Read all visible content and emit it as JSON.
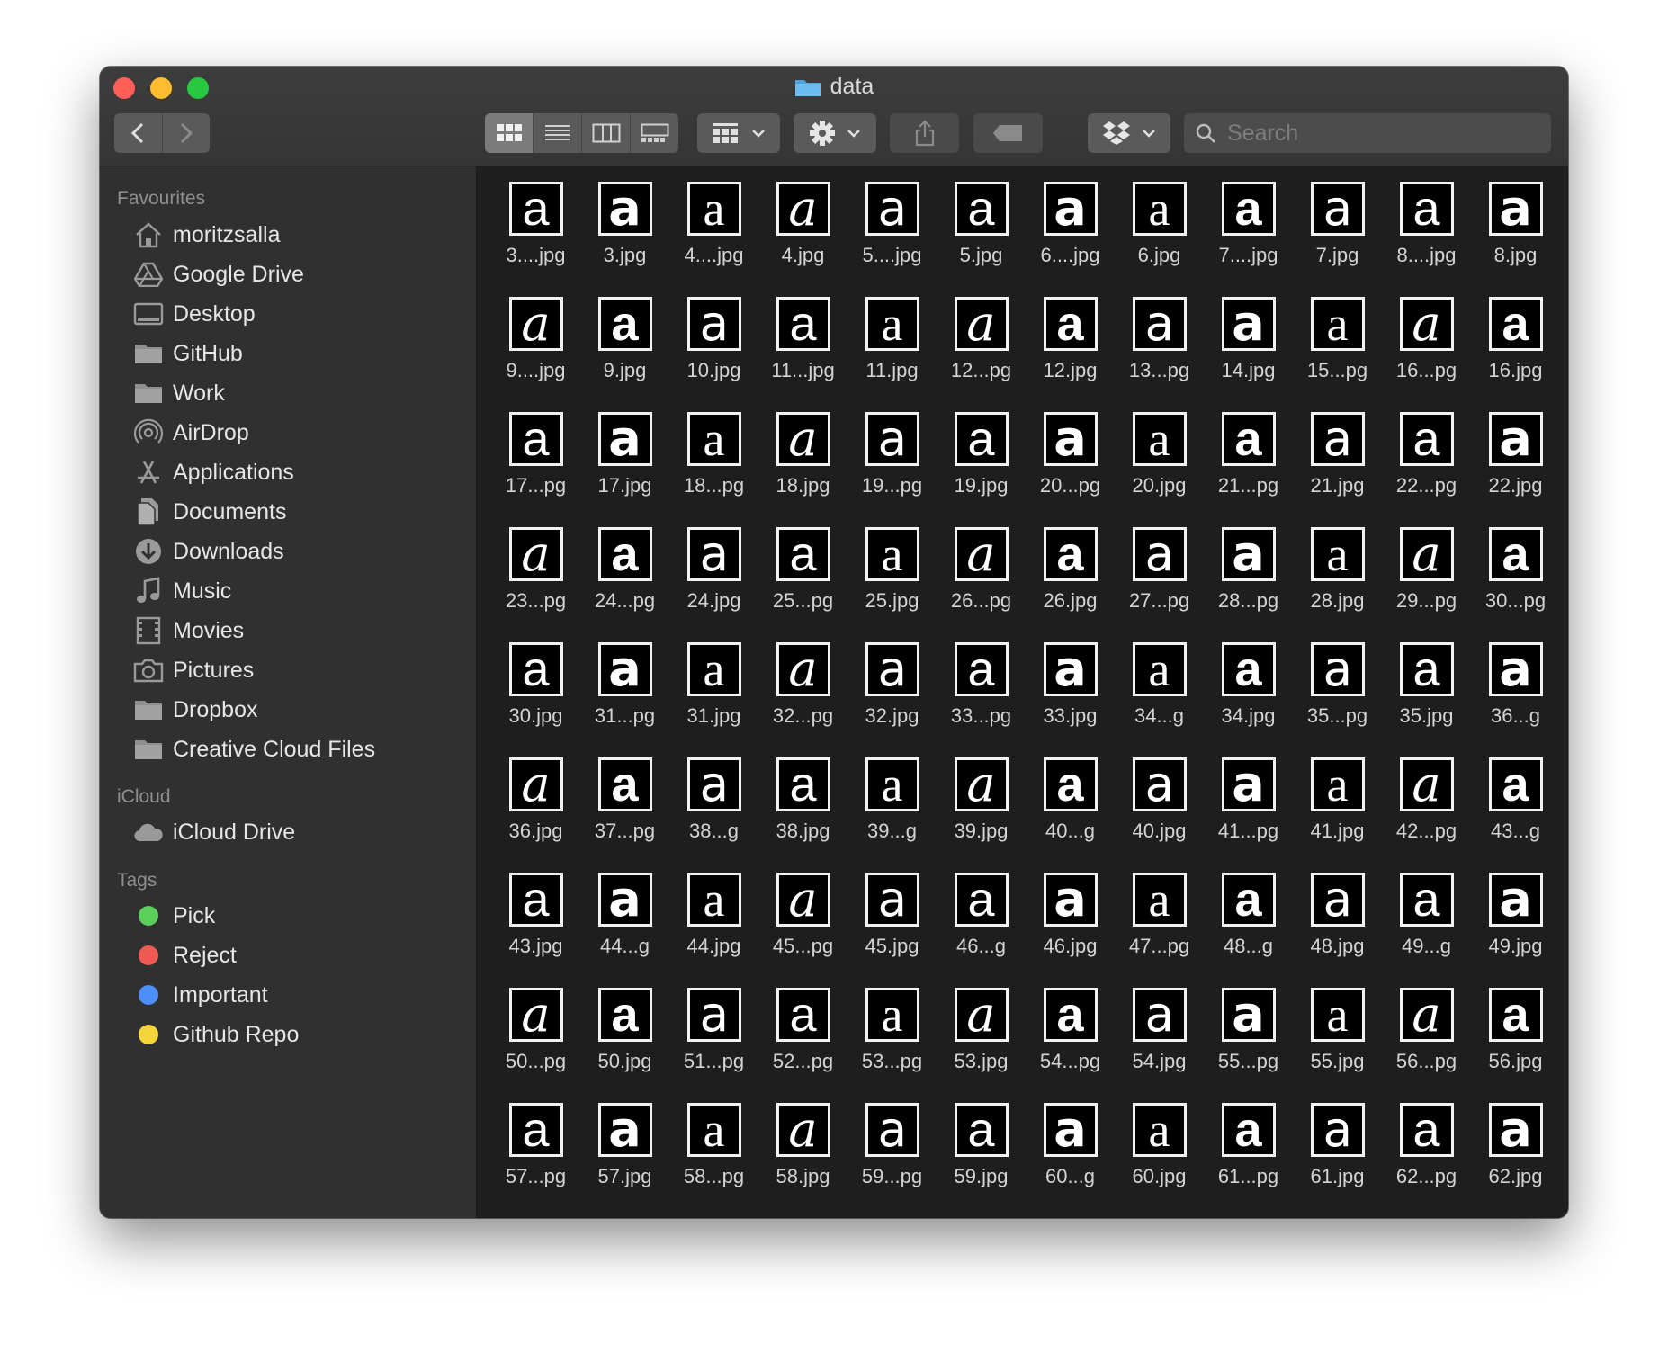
{
  "window": {
    "title": "data",
    "search_placeholder": "Search"
  },
  "toolbar": {
    "back_icon": "chevron-left-icon",
    "forward_icon": "chevron-right-icon",
    "view_modes": [
      "icon-view",
      "list-view",
      "column-view",
      "gallery-view"
    ],
    "active_view": "icon-view"
  },
  "sidebar": {
    "favourites_header": "Favourites",
    "favourites": [
      {
        "label": "moritzsalla",
        "icon": "home-icon"
      },
      {
        "label": "Google Drive",
        "icon": "google-drive-icon"
      },
      {
        "label": "Desktop",
        "icon": "desktop-icon"
      },
      {
        "label": "GitHub",
        "icon": "folder-icon"
      },
      {
        "label": "Work",
        "icon": "folder-icon"
      },
      {
        "label": "AirDrop",
        "icon": "airdrop-icon"
      },
      {
        "label": "Applications",
        "icon": "applications-icon"
      },
      {
        "label": "Documents",
        "icon": "documents-icon"
      },
      {
        "label": "Downloads",
        "icon": "downloads-icon"
      },
      {
        "label": "Music",
        "icon": "music-icon"
      },
      {
        "label": "Movies",
        "icon": "movies-icon"
      },
      {
        "label": "Pictures",
        "icon": "camera-icon"
      },
      {
        "label": "Dropbox",
        "icon": "folder-icon"
      },
      {
        "label": "Creative Cloud Files",
        "icon": "folder-icon"
      }
    ],
    "icloud_header": "iCloud",
    "icloud": [
      {
        "label": "iCloud Drive",
        "icon": "cloud-icon"
      }
    ],
    "tags_header": "Tags",
    "tags": [
      {
        "label": "Pick",
        "color": "#5ad05a"
      },
      {
        "label": "Reject",
        "color": "#ef5b52"
      },
      {
        "label": "Important",
        "color": "#4d8ef7"
      },
      {
        "label": "Github Repo",
        "color": "#f5d43c"
      }
    ]
  },
  "files": [
    "3....jpg",
    "3.jpg",
    "4....jpg",
    "4.jpg",
    "5....jpg",
    "5.jpg",
    "6....jpg",
    "6.jpg",
    "7....jpg",
    "7.jpg",
    "8....jpg",
    "8.jpg",
    "9....jpg",
    "9.jpg",
    "10.jpg",
    "11...jpg",
    "11.jpg",
    "12...pg",
    "12.jpg",
    "13...pg",
    "14.jpg",
    "15...pg",
    "16...pg",
    "16.jpg",
    "17...pg",
    "17.jpg",
    "18...pg",
    "18.jpg",
    "19...pg",
    "19.jpg",
    "20...pg",
    "20.jpg",
    "21...pg",
    "21.jpg",
    "22...pg",
    "22.jpg",
    "23...pg",
    "24...pg",
    "24.jpg",
    "25...pg",
    "25.jpg",
    "26...pg",
    "26.jpg",
    "27...pg",
    "28...pg",
    "28.jpg",
    "29...pg",
    "30...pg",
    "30.jpg",
    "31...pg",
    "31.jpg",
    "32...pg",
    "32.jpg",
    "33...pg",
    "33.jpg",
    "34...g",
    "34.jpg",
    "35...pg",
    "35.jpg",
    "36...g",
    "36.jpg",
    "37...pg",
    "38...g",
    "38.jpg",
    "39...g",
    "39.jpg",
    "40...g",
    "40.jpg",
    "41...pg",
    "41.jpg",
    "42...pg",
    "43...g",
    "43.jpg",
    "44...g",
    "44.jpg",
    "45...pg",
    "45.jpg",
    "46...g",
    "46.jpg",
    "47...pg",
    "48...g",
    "48.jpg",
    "49...g",
    "49.jpg",
    "50...pg",
    "50.jpg",
    "51...pg",
    "52...pg",
    "53...pg",
    "53.jpg",
    "54...pg",
    "54.jpg",
    "55...pg",
    "55.jpg",
    "56...pg",
    "56.jpg",
    "57...pg",
    "57.jpg",
    "58...pg",
    "58.jpg",
    "59...pg",
    "59.jpg",
    "60...g",
    "60.jpg",
    "61...pg",
    "61.jpg",
    "62...pg",
    "62.jpg"
  ],
  "thumbnail_glyph": "a"
}
